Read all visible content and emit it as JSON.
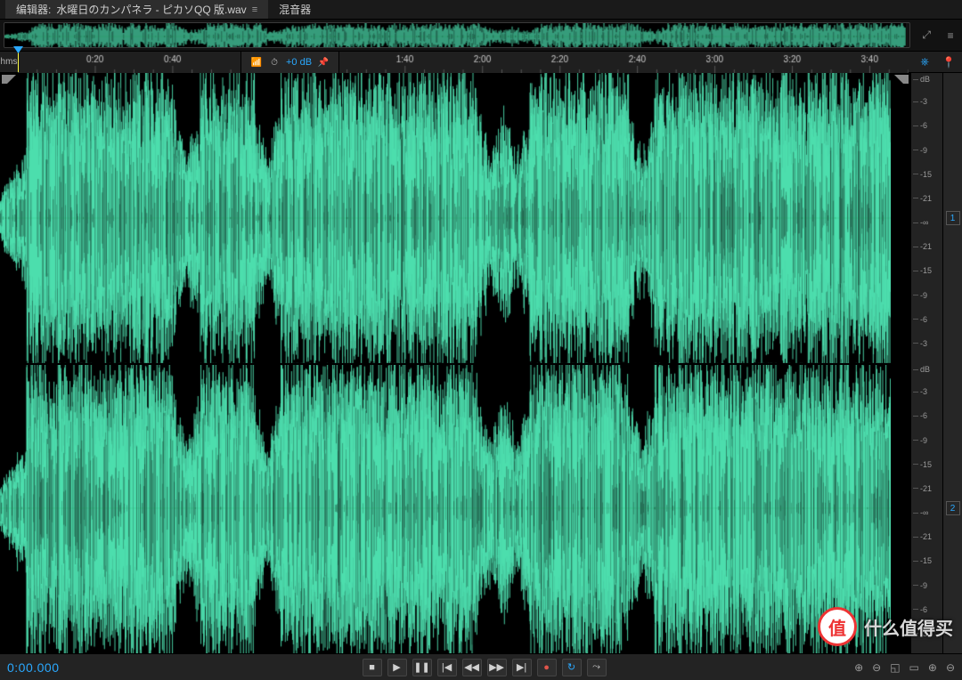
{
  "tabs": {
    "editor_prefix": "编辑器:",
    "filename": "水曜日のカンパネラ - ピカソQQ 版.wav",
    "close_glyph": "≡",
    "mixer": "混音器"
  },
  "overview": {
    "tool_zoom_glyph": "⤢",
    "tool_list_glyph": "≡"
  },
  "ruler": {
    "unit_label": "hms",
    "ticks": [
      "0:20",
      "0:40",
      "1:40",
      "2:00",
      "2:20",
      "2:40",
      "3:00",
      "3:20",
      "3:40"
    ],
    "tool_marker_glyph": "⎈",
    "tool_pin_glyph": "📍"
  },
  "gain": {
    "bars_glyph": "📶",
    "clock_glyph": "⏱",
    "value": "+0 dB",
    "pin_glyph": "📌"
  },
  "db_scale": {
    "unit": "dB",
    "marks": [
      "-3",
      "-6",
      "-9",
      "-15",
      "-21",
      "-∞",
      "-21",
      "-15",
      "-9",
      "-6",
      "-3"
    ]
  },
  "channels": {
    "ch1": "1",
    "ch2": "2"
  },
  "transport": {
    "timecode": "0:00.000",
    "stop": "■",
    "play": "▶",
    "pause": "❚❚",
    "to_start": "|◀",
    "rewind": "◀◀",
    "forward": "▶▶",
    "to_end": "▶|",
    "record": "●",
    "loop": "↻",
    "skip": "⤳"
  },
  "zoom_tools": {
    "zoom_in": "⊕",
    "zoom_out": "⊖",
    "zoom_full": "◱",
    "zoom_sel": "▭",
    "zoom_in_v": "⊕",
    "zoom_out_v": "⊖"
  },
  "watermark": {
    "badge": "值",
    "text": "什么值得买"
  },
  "colors": {
    "waveform": "#4fe0b0",
    "accent": "#2aa9ff"
  },
  "chart_data": {
    "type": "waveform",
    "channels": 2,
    "duration_sec": 230,
    "sample_display": "amplitude_db",
    "y_axis": {
      "unit": "dB",
      "range_top": 0,
      "range_center": "-∞",
      "mirrored": true,
      "ticks": [
        -3,
        -6,
        -9,
        -15,
        -21
      ]
    },
    "time_axis": {
      "unit": "seconds",
      "visible_start": 0,
      "visible_end": 230,
      "major_tick_sec": 20
    },
    "note": "dense stereo music waveform; peaks near 0 dB throughout with quieter intro before ~0:10 and brief dips near 0:50, 1:10, 2:10"
  }
}
